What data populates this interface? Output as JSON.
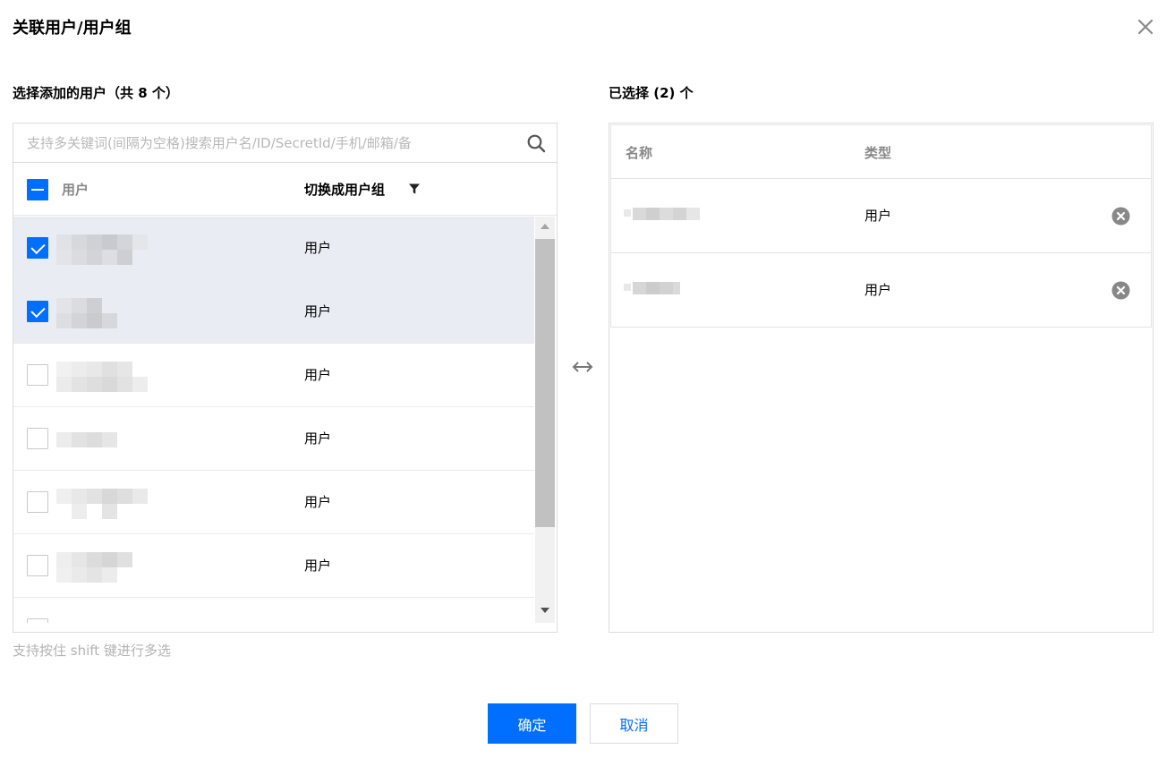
{
  "dialog": {
    "title": "关联用户/用户组"
  },
  "left": {
    "title": "选择添加的用户（共 8 个）",
    "search_placeholder": "支持多关键词(间隔为空格)搜索用户名/ID/SecretId/手机/邮箱/备",
    "header_user": "用户",
    "header_switch": "切换成用户组",
    "rows": [
      {
        "type": "用户",
        "checked": true
      },
      {
        "type": "用户",
        "checked": true
      },
      {
        "type": "用户",
        "checked": false
      },
      {
        "type": "用户",
        "checked": false
      },
      {
        "type": "用户",
        "checked": false
      },
      {
        "type": "用户",
        "checked": false
      }
    ],
    "hint": "支持按住 shift 键进行多选"
  },
  "right": {
    "title": "已选择 (2) 个",
    "header_name": "名称",
    "header_type": "类型",
    "rows": [
      {
        "type": "用户"
      },
      {
        "type": "用户"
      }
    ]
  },
  "buttons": {
    "ok": "确定",
    "cancel": "取消"
  },
  "colors": {
    "primary": "#006eff",
    "selected_row": "#e9edf3"
  },
  "icons": [
    "close-icon",
    "search-icon",
    "filter-icon",
    "swap-icon",
    "remove-icon"
  ]
}
